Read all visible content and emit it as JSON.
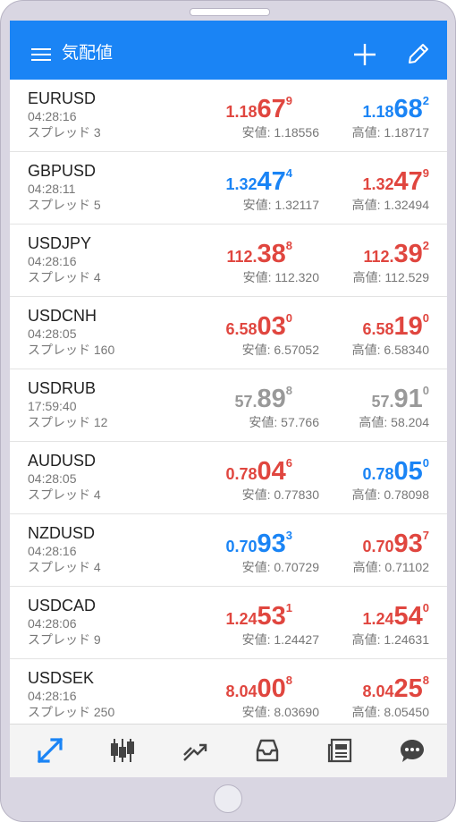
{
  "app": {
    "title": "気配値"
  },
  "colors": {
    "up": "#1a84f5",
    "down": "#e0463f",
    "flat": "#999999",
    "accent": "#1a84f5"
  },
  "icons": {
    "menu": "menu-icon",
    "add": "add-icon",
    "edit": "edit-icon",
    "nav": [
      "quotes-icon",
      "chart-candles-icon",
      "trade-icon",
      "history-inbox-icon",
      "news-icon",
      "chat-icon"
    ]
  },
  "quotes": [
    {
      "symbol": "EURUSD",
      "time": "04:28:16",
      "spread": "スプレッド 3",
      "bid": {
        "small": "1.18",
        "big": "67",
        "sup": "9",
        "dir": "down"
      },
      "ask": {
        "small": "1.18",
        "big": "68",
        "sup": "2",
        "dir": "up"
      },
      "low": "安値: 1.18556",
      "high": "高値: 1.18717"
    },
    {
      "symbol": "GBPUSD",
      "time": "04:28:11",
      "spread": "スプレッド 5",
      "bid": {
        "small": "1.32",
        "big": "47",
        "sup": "4",
        "dir": "up"
      },
      "ask": {
        "small": "1.32",
        "big": "47",
        "sup": "9",
        "dir": "down"
      },
      "low": "安値: 1.32117",
      "high": "高値: 1.32494"
    },
    {
      "symbol": "USDJPY",
      "time": "04:28:16",
      "spread": "スプレッド 4",
      "bid": {
        "small": "112.",
        "big": "38",
        "sup": "8",
        "dir": "down"
      },
      "ask": {
        "small": "112.",
        "big": "39",
        "sup": "2",
        "dir": "down"
      },
      "low": "安値: 112.320",
      "high": "高値: 112.529"
    },
    {
      "symbol": "USDCNH",
      "time": "04:28:05",
      "spread": "スプレッド 160",
      "bid": {
        "small": "6.58",
        "big": "03",
        "sup": "0",
        "dir": "down"
      },
      "ask": {
        "small": "6.58",
        "big": "19",
        "sup": "0",
        "dir": "down"
      },
      "low": "安値: 6.57052",
      "high": "高値: 6.58340"
    },
    {
      "symbol": "USDRUB",
      "time": "17:59:40",
      "spread": "スプレッド 12",
      "bid": {
        "small": "57.",
        "big": "89",
        "sup": "8",
        "dir": "flat"
      },
      "ask": {
        "small": "57.",
        "big": "91",
        "sup": "0",
        "dir": "flat"
      },
      "low": "安値: 57.766",
      "high": "高値: 58.204"
    },
    {
      "symbol": "AUDUSD",
      "time": "04:28:05",
      "spread": "スプレッド 4",
      "bid": {
        "small": "0.78",
        "big": "04",
        "sup": "6",
        "dir": "down"
      },
      "ask": {
        "small": "0.78",
        "big": "05",
        "sup": "0",
        "dir": "up"
      },
      "low": "安値: 0.77830",
      "high": "高値: 0.78098"
    },
    {
      "symbol": "NZDUSD",
      "time": "04:28:16",
      "spread": "スプレッド 4",
      "bid": {
        "small": "0.70",
        "big": "93",
        "sup": "3",
        "dir": "up"
      },
      "ask": {
        "small": "0.70",
        "big": "93",
        "sup": "7",
        "dir": "down"
      },
      "low": "安値: 0.70729",
      "high": "高値: 0.71102"
    },
    {
      "symbol": "USDCAD",
      "time": "04:28:06",
      "spread": "スプレッド 9",
      "bid": {
        "small": "1.24",
        "big": "53",
        "sup": "1",
        "dir": "down"
      },
      "ask": {
        "small": "1.24",
        "big": "54",
        "sup": "0",
        "dir": "down"
      },
      "low": "安値: 1.24427",
      "high": "高値: 1.24631"
    },
    {
      "symbol": "USDSEK",
      "time": "04:28:16",
      "spread": "スプレッド 250",
      "bid": {
        "small": "8.04",
        "big": "00",
        "sup": "8",
        "dir": "down"
      },
      "ask": {
        "small": "8.04",
        "big": "25",
        "sup": "8",
        "dir": "down"
      },
      "low": "安値: 8.03690",
      "high": "高値: 8.05450"
    }
  ]
}
